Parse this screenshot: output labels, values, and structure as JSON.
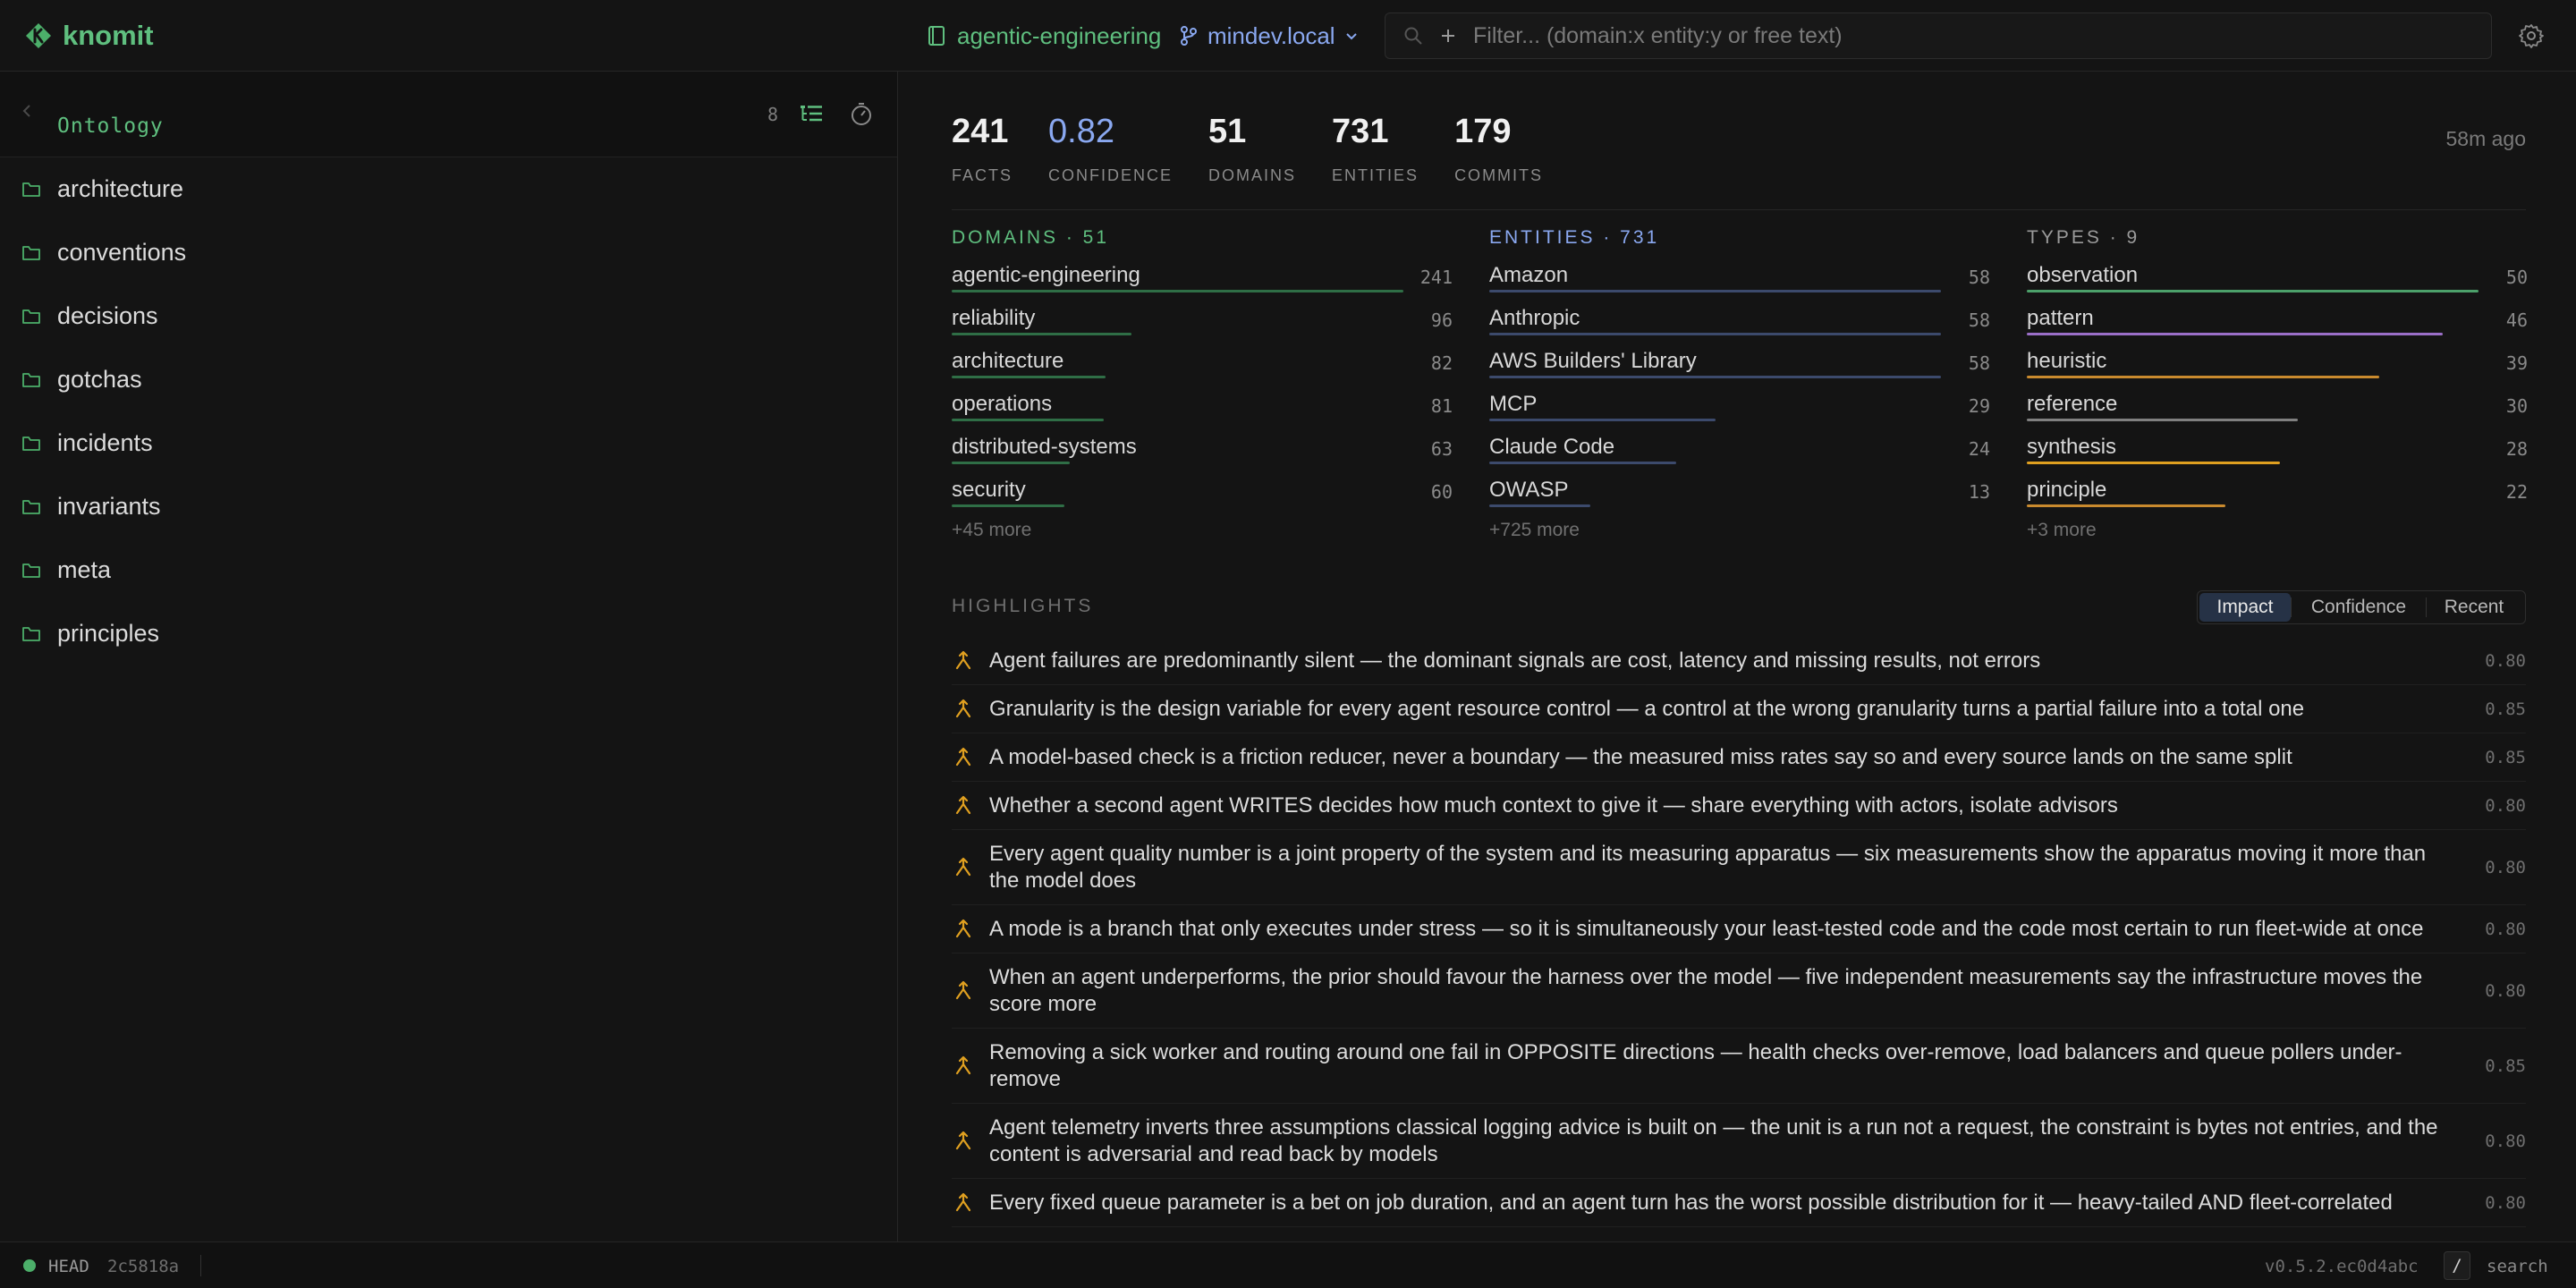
{
  "app": {
    "name": "knomit"
  },
  "header": {
    "repo": "agentic-engineering",
    "branch": "mindev.local",
    "filter_placeholder": "Filter... (domain:x entity:y or free text)"
  },
  "sidebar": {
    "title": "Ontology",
    "count": "8",
    "folders": [
      "architecture",
      "conventions",
      "decisions",
      "gotchas",
      "incidents",
      "invariants",
      "meta",
      "principles"
    ]
  },
  "stats": [
    {
      "value": "241",
      "label": "FACTS"
    },
    {
      "value": "0.82",
      "label": "CONFIDENCE"
    },
    {
      "value": "51",
      "label": "DOMAINS"
    },
    {
      "value": "731",
      "label": "ENTITIES"
    },
    {
      "value": "179",
      "label": "COMMITS"
    }
  ],
  "updated": "58m ago",
  "domains": {
    "title": "DOMAINS · 51",
    "color": "#5fbf7f",
    "bar_color": "#2f6e46",
    "items": [
      {
        "name": "agentic-engineering",
        "count": 241
      },
      {
        "name": "reliability",
        "count": 96
      },
      {
        "name": "architecture",
        "count": 82
      },
      {
        "name": "operations",
        "count": 81
      },
      {
        "name": "distributed-systems",
        "count": 63
      },
      {
        "name": "security",
        "count": 60
      }
    ],
    "more": "+45 more"
  },
  "entities": {
    "title": "ENTITIES · 731",
    "color": "#8aa8f0",
    "bar_color": "#3c4a6c",
    "items": [
      {
        "name": "Amazon",
        "count": 58
      },
      {
        "name": "Anthropic",
        "count": 58
      },
      {
        "name": "AWS Builders' Library",
        "count": 58
      },
      {
        "name": "MCP",
        "count": 29
      },
      {
        "name": "Claude Code",
        "count": 24
      },
      {
        "name": "OWASP",
        "count": 13
      }
    ],
    "more": "+725 more"
  },
  "types": {
    "title": "TYPES · 9",
    "color": "#9a9a9a",
    "items": [
      {
        "name": "observation",
        "count": 50,
        "color": "#4ca06a"
      },
      {
        "name": "pattern",
        "count": 46,
        "color": "#9b6fc8"
      },
      {
        "name": "heuristic",
        "count": 39,
        "color": "#c98a2e"
      },
      {
        "name": "reference",
        "count": 30,
        "color": "#808080"
      },
      {
        "name": "synthesis",
        "count": 28,
        "color": "#e0a020"
      },
      {
        "name": "principle",
        "count": 22,
        "color": "#c98a2e"
      }
    ],
    "more": "+3 more"
  },
  "highlights": {
    "title": "HIGHLIGHTS",
    "tabs": [
      "Impact",
      "Confidence",
      "Recent"
    ],
    "active_tab": "Impact",
    "icon_color": "#e0a020",
    "items": [
      {
        "text": "Agent failures are predominantly silent — the dominant signals are cost, latency and missing results, not errors",
        "score": "0.80"
      },
      {
        "text": "Granularity is the design variable for every agent resource control — a control at the wrong granularity turns a partial failure into a total one",
        "score": "0.85"
      },
      {
        "text": "A model-based check is a friction reducer, never a boundary — the measured miss rates say so and every source lands on the same split",
        "score": "0.85"
      },
      {
        "text": "Whether a second agent WRITES decides how much context to give it — share everything with actors, isolate advisors",
        "score": "0.80"
      },
      {
        "text": "Every agent quality number is a joint property of the system and its measuring apparatus — six measurements show the apparatus moving it more than the model does",
        "score": "0.80"
      },
      {
        "text": "A mode is a branch that only executes under stress — so it is simultaneously your least-tested code and the code most certain to run fleet-wide at once",
        "score": "0.80"
      },
      {
        "text": "When an agent underperforms, the prior should favour the harness over the model — five independent measurements say the infrastructure moves the score more",
        "score": "0.80"
      },
      {
        "text": "Removing a sick worker and routing around one fail in OPPOSITE directions — health checks over-remove, load balancers and queue pollers under-remove",
        "score": "0.85"
      },
      {
        "text": "Agent telemetry inverts three assumptions classical logging advice is built on — the unit is a run not a request, the constraint is bytes not entries, and the content is adversarial and read back by models",
        "score": "0.80"
      },
      {
        "text": "Every fixed queue parameter is a bet on job duration, and an agent turn has the worst possible distribution for it — heavy-tailed AND fleet-correlated",
        "score": "0.80"
      }
    ]
  },
  "statusbar": {
    "head": "HEAD",
    "hash": "2c5818a",
    "version": "v0.5.2.ec0d4abc",
    "key": "/",
    "search": "search"
  }
}
